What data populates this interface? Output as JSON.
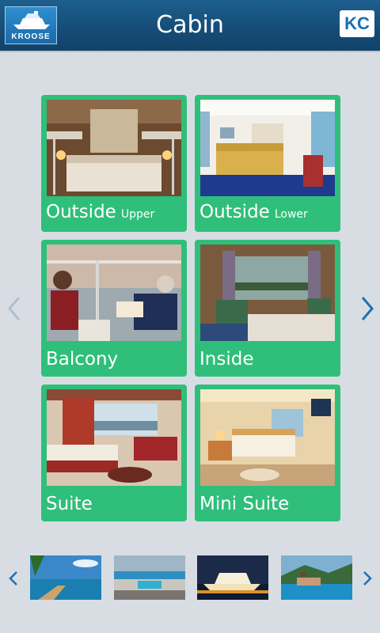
{
  "header": {
    "logo_text": "KROOSE",
    "title": "Cabin",
    "profile_initials": "KC"
  },
  "cabins": [
    {
      "label": "Outside",
      "sublabel": "Upper"
    },
    {
      "label": "Outside",
      "sublabel": "Lower"
    },
    {
      "label": "Balcony",
      "sublabel": ""
    },
    {
      "label": "Inside",
      "sublabel": ""
    },
    {
      "label": "Suite",
      "sublabel": ""
    },
    {
      "label": "Mini Suite",
      "sublabel": ""
    }
  ],
  "icons": {
    "prev": "chevron-left-icon",
    "next": "chevron-right-icon"
  },
  "colors": {
    "header": "#154c76",
    "card": "#2fbf7a",
    "background": "#d8dde3",
    "arrow_active": "#1f6fb0",
    "arrow_inactive": "#aebfcd"
  }
}
